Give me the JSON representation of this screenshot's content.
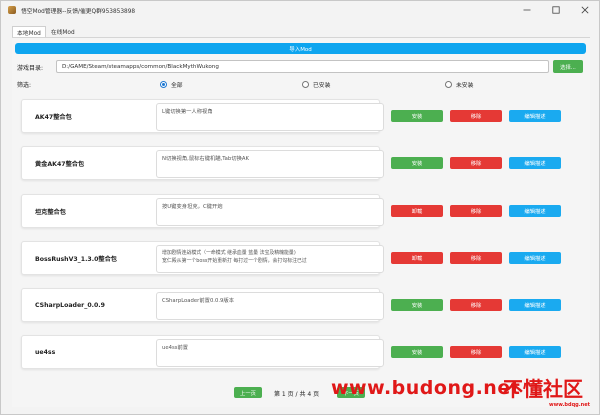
{
  "window": {
    "title": "悟空Mod管理器--反馈/催更Q群953853898",
    "minimize_icon": "minimize-icon",
    "maximize_icon": "maximize-icon",
    "close_icon": "close-icon"
  },
  "tabs": [
    {
      "label": "本地Mod",
      "active": true
    },
    {
      "label": "在线Mod",
      "active": false
    }
  ],
  "import_button": "导入Mod",
  "game_dir": {
    "label": "游戏目录:",
    "value": "D:/GAME/Steam/steamapps/common/BlackMythWukong",
    "browse": "选择..."
  },
  "filter": {
    "label": "筛选:",
    "options": [
      {
        "label": "全部",
        "selected": true
      },
      {
        "label": "已安装",
        "selected": false
      },
      {
        "label": "未安装",
        "selected": false
      }
    ]
  },
  "mods": [
    {
      "name": "AK47整合包",
      "desc": "L键切换第一人称视角",
      "action": "安装",
      "action_color": "#4caf50",
      "remove": "移除",
      "edit": "编辑描述"
    },
    {
      "name": "黄金AK47整合包",
      "desc": "N切换视角,鼠标右键机瞄,Tab切换AK",
      "action": "安装",
      "action_color": "#4caf50",
      "remove": "移除",
      "edit": "编辑描述"
    },
    {
      "name": "坦克整合包",
      "desc": "按U键变身坦克，C键开炮",
      "action": "卸载",
      "action_color": "#e53935",
      "remove": "移除",
      "edit": "编辑描述"
    },
    {
      "name": "BossRushV3_1.3.0整合包",
      "desc": "增加剧情连战模式（一命模式 继承血量 蓝量 法宝及精魄能量)\n宽仁殿从第一个boss开始重新打 每打过一个剧情，会打勾标注已过",
      "action": "卸载",
      "action_color": "#e53935",
      "remove": "移除",
      "edit": "编辑描述"
    },
    {
      "name": "CSharpLoader_0.0.9",
      "desc": "CSharpLoader前置0.0.9版本",
      "action": "安装",
      "action_color": "#4caf50",
      "remove": "移除",
      "edit": "编辑描述"
    },
    {
      "name": "ue4ss",
      "desc": "ue4ss前置",
      "action": "安装",
      "action_color": "#4caf50",
      "remove": "移除",
      "edit": "编辑描述"
    }
  ],
  "pager": {
    "prev": "上一页",
    "info": "第 1 页 / 共 4 页",
    "next": "下一页"
  },
  "watermark": {
    "site": "www.bdqg.net",
    "name": "不懂社区",
    "url": "www.budong.net"
  }
}
